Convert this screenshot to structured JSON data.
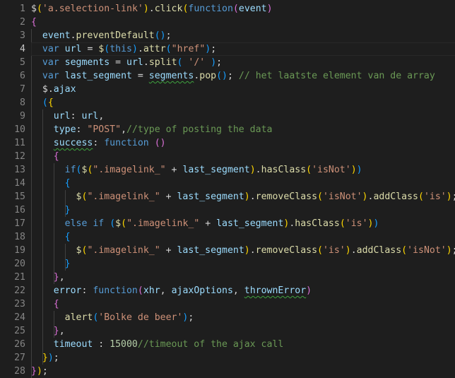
{
  "editor": {
    "lines": [
      {
        "n": "1",
        "segs": [
          [
            "$",
            "p"
          ],
          [
            "(",
            "b1"
          ],
          [
            "'a.selection-link'",
            "s"
          ],
          [
            ")",
            "b1"
          ],
          [
            ".",
            "p"
          ],
          [
            "click",
            "f"
          ],
          [
            "(",
            "b1"
          ],
          [
            "function",
            "k"
          ],
          [
            "(",
            "b2"
          ],
          [
            "event",
            "v"
          ],
          [
            ")",
            "b2"
          ]
        ]
      },
      {
        "n": "2",
        "segs": [
          [
            "{",
            "b2"
          ]
        ]
      },
      {
        "n": "3",
        "segs": [
          [
            "  ",
            "p"
          ],
          [
            "event",
            "v"
          ],
          [
            ".",
            "p"
          ],
          [
            "preventDefault",
            "f"
          ],
          [
            "(",
            "b3"
          ],
          [
            ")",
            "b3"
          ],
          [
            ";",
            "p"
          ]
        ]
      },
      {
        "n": "4",
        "segs": [
          [
            "  ",
            "p"
          ],
          [
            "var",
            "k"
          ],
          [
            " ",
            "p"
          ],
          [
            "url",
            "v"
          ],
          [
            " = ",
            "p"
          ],
          [
            "$",
            "f"
          ],
          [
            "(",
            "b3"
          ],
          [
            "this",
            "k"
          ],
          [
            ")",
            "b3"
          ],
          [
            ".",
            "p"
          ],
          [
            "attr",
            "f"
          ],
          [
            "(",
            "b3"
          ],
          [
            "\"href\"",
            "s"
          ],
          [
            ")",
            "b3"
          ],
          [
            ";",
            "p"
          ]
        ]
      },
      {
        "n": "5",
        "segs": [
          [
            "  ",
            "p"
          ],
          [
            "var",
            "k"
          ],
          [
            " ",
            "p"
          ],
          [
            "segments",
            "v"
          ],
          [
            " = ",
            "p"
          ],
          [
            "url",
            "v"
          ],
          [
            ".",
            "p"
          ],
          [
            "split",
            "f"
          ],
          [
            "(",
            "b3"
          ],
          [
            " ",
            "p"
          ],
          [
            "'/'",
            "s"
          ],
          [
            " ",
            "p"
          ],
          [
            ")",
            "b3"
          ],
          [
            ";",
            "p"
          ]
        ]
      },
      {
        "n": "6",
        "segs": [
          [
            "  ",
            "p"
          ],
          [
            "var",
            "k"
          ],
          [
            " ",
            "p"
          ],
          [
            "last_segment",
            "v"
          ],
          [
            " = ",
            "p"
          ],
          [
            "segments",
            "v",
            "sq"
          ],
          [
            ".",
            "p"
          ],
          [
            "pop",
            "f"
          ],
          [
            "(",
            "b3"
          ],
          [
            ")",
            "b3"
          ],
          [
            "; ",
            "p"
          ],
          [
            "// het laatste element van de array",
            "c"
          ]
        ]
      },
      {
        "n": "7",
        "segs": [
          [
            "  ",
            "p"
          ],
          [
            "$",
            "p"
          ],
          [
            ".",
            "p"
          ],
          [
            "ajax",
            "v"
          ]
        ]
      },
      {
        "n": "8",
        "segs": [
          [
            "  ",
            "p"
          ],
          [
            "(",
            "b3"
          ],
          [
            "{",
            "b1"
          ]
        ]
      },
      {
        "n": "9",
        "segs": [
          [
            "    ",
            "p"
          ],
          [
            "url",
            "v"
          ],
          [
            ": ",
            "p"
          ],
          [
            "url",
            "v"
          ],
          [
            ",",
            "p"
          ]
        ]
      },
      {
        "n": "10",
        "segs": [
          [
            "    ",
            "p"
          ],
          [
            "type",
            "v"
          ],
          [
            ": ",
            "p"
          ],
          [
            "\"POST\"",
            "s"
          ],
          [
            ",",
            "p"
          ],
          [
            "//type of posting the data",
            "c"
          ]
        ]
      },
      {
        "n": "11",
        "segs": [
          [
            "    ",
            "p"
          ],
          [
            "success",
            "v",
            "sq"
          ],
          [
            ": ",
            "p"
          ],
          [
            "function",
            "k"
          ],
          [
            " ",
            "p"
          ],
          [
            "(",
            "b2"
          ],
          [
            ")",
            "b2"
          ]
        ]
      },
      {
        "n": "12",
        "segs": [
          [
            "    ",
            "p"
          ],
          [
            "{",
            "b2"
          ]
        ]
      },
      {
        "n": "13",
        "segs": [
          [
            "      ",
            "p"
          ],
          [
            "if",
            "k"
          ],
          [
            "(",
            "b3"
          ],
          [
            "$",
            "f"
          ],
          [
            "(",
            "b1"
          ],
          [
            "\".imagelink_\"",
            "s"
          ],
          [
            " + ",
            "p"
          ],
          [
            "last_segment",
            "v"
          ],
          [
            ")",
            "b1"
          ],
          [
            ".",
            "p"
          ],
          [
            "hasClass",
            "f"
          ],
          [
            "(",
            "b1"
          ],
          [
            "'isNot'",
            "s"
          ],
          [
            ")",
            "b1"
          ],
          [
            ")",
            "b3"
          ]
        ]
      },
      {
        "n": "14",
        "segs": [
          [
            "      ",
            "p"
          ],
          [
            "{",
            "b3"
          ]
        ]
      },
      {
        "n": "15",
        "segs": [
          [
            "        ",
            "p"
          ],
          [
            "$",
            "f"
          ],
          [
            "(",
            "b1"
          ],
          [
            "\".imagelink_\"",
            "s"
          ],
          [
            " + ",
            "p"
          ],
          [
            "last_segment",
            "v"
          ],
          [
            ")",
            "b1"
          ],
          [
            ".",
            "p"
          ],
          [
            "removeClass",
            "f"
          ],
          [
            "(",
            "b1"
          ],
          [
            "'isNot'",
            "s"
          ],
          [
            ")",
            "b1"
          ],
          [
            ".",
            "p"
          ],
          [
            "addClass",
            "f"
          ],
          [
            "(",
            "b1"
          ],
          [
            "'is'",
            "s"
          ],
          [
            ")",
            "b1"
          ],
          [
            ";",
            "p"
          ]
        ]
      },
      {
        "n": "16",
        "segs": [
          [
            "      ",
            "p"
          ],
          [
            "}",
            "b3"
          ]
        ]
      },
      {
        "n": "17",
        "segs": [
          [
            "      ",
            "p"
          ],
          [
            "else",
            "k"
          ],
          [
            " ",
            "p"
          ],
          [
            "if",
            "k"
          ],
          [
            " ",
            "p"
          ],
          [
            "(",
            "b3"
          ],
          [
            "$",
            "f"
          ],
          [
            "(",
            "b1"
          ],
          [
            "\".imagelink_\"",
            "s"
          ],
          [
            " + ",
            "p"
          ],
          [
            "last_segment",
            "v"
          ],
          [
            ")",
            "b1"
          ],
          [
            ".",
            "p"
          ],
          [
            "hasClass",
            "f"
          ],
          [
            "(",
            "b1"
          ],
          [
            "'is'",
            "s"
          ],
          [
            ")",
            "b1"
          ],
          [
            ")",
            "b3"
          ]
        ]
      },
      {
        "n": "18",
        "segs": [
          [
            "      ",
            "p"
          ],
          [
            "{",
            "b3"
          ]
        ]
      },
      {
        "n": "19",
        "segs": [
          [
            "        ",
            "p"
          ],
          [
            "$",
            "f"
          ],
          [
            "(",
            "b1"
          ],
          [
            "\".imagelink_\"",
            "s"
          ],
          [
            " + ",
            "p"
          ],
          [
            "last_segment",
            "v"
          ],
          [
            ")",
            "b1"
          ],
          [
            ".",
            "p"
          ],
          [
            "removeClass",
            "f"
          ],
          [
            "(",
            "b1"
          ],
          [
            "'is'",
            "s"
          ],
          [
            ")",
            "b1"
          ],
          [
            ".",
            "p"
          ],
          [
            "addClass",
            "f"
          ],
          [
            "(",
            "b1"
          ],
          [
            "'isNot'",
            "s"
          ],
          [
            ")",
            "b1"
          ],
          [
            ";",
            "p"
          ]
        ]
      },
      {
        "n": "20",
        "segs": [
          [
            "      ",
            "p"
          ],
          [
            "}",
            "b3"
          ]
        ]
      },
      {
        "n": "21",
        "segs": [
          [
            "    ",
            "p"
          ],
          [
            "}",
            "b2"
          ],
          [
            ",",
            "p"
          ]
        ]
      },
      {
        "n": "22",
        "segs": [
          [
            "    ",
            "p"
          ],
          [
            "error",
            "v"
          ],
          [
            ": ",
            "p"
          ],
          [
            "function",
            "k"
          ],
          [
            "(",
            "b2"
          ],
          [
            "xhr",
            "v"
          ],
          [
            ", ",
            "p"
          ],
          [
            "ajaxOptions",
            "v"
          ],
          [
            ", ",
            "p"
          ],
          [
            "thrownError",
            "v",
            "sq"
          ],
          [
            ")",
            "b2"
          ]
        ]
      },
      {
        "n": "23",
        "segs": [
          [
            "    ",
            "p"
          ],
          [
            "{",
            "b2"
          ]
        ]
      },
      {
        "n": "24",
        "segs": [
          [
            "      ",
            "p"
          ],
          [
            "alert",
            "f"
          ],
          [
            "(",
            "b3"
          ],
          [
            "'Bolke de beer'",
            "s"
          ],
          [
            ")",
            "b3"
          ],
          [
            ";",
            "p"
          ]
        ]
      },
      {
        "n": "25",
        "segs": [
          [
            "    ",
            "p"
          ],
          [
            "}",
            "b2"
          ],
          [
            ",",
            "p"
          ]
        ]
      },
      {
        "n": "26",
        "segs": [
          [
            "    ",
            "p"
          ],
          [
            "timeout",
            "v"
          ],
          [
            " : ",
            "p"
          ],
          [
            "15000",
            "n"
          ],
          [
            "//timeout of the ajax call",
            "c"
          ]
        ]
      },
      {
        "n": "27",
        "segs": [
          [
            "  ",
            "p"
          ],
          [
            "}",
            "b1"
          ],
          [
            ")",
            "b3"
          ],
          [
            ";",
            "p"
          ]
        ]
      },
      {
        "n": "28",
        "segs": [
          [
            "}",
            "b2"
          ],
          [
            ")",
            "b1"
          ],
          [
            ";",
            "p"
          ]
        ]
      }
    ],
    "active_line": "4"
  }
}
